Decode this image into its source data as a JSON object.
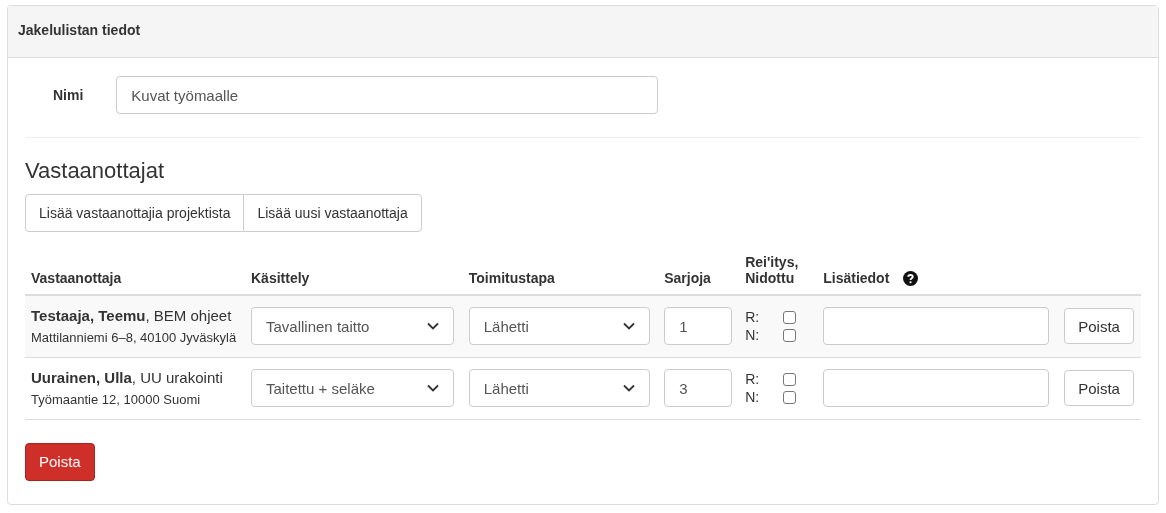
{
  "panel": {
    "title": "Jakelulistan tiedot"
  },
  "name_field": {
    "label": "Nimi",
    "value": "Kuvat työmaalle"
  },
  "recipients": {
    "heading": "Vastaanottajat",
    "buttons": [
      "Lisää vastaanottajia projektista",
      "Lisää uusi vastaanottaja"
    ],
    "columns": [
      "Vastaanottaja",
      "Käsittely",
      "Toimitustapa",
      "Sarjoja",
      "Rei'itys, Nidottu",
      "Lisätiedot"
    ],
    "rows": [
      {
        "name": "Testaaja, Teemu",
        "org": ", BEM ohjeet",
        "address": "Mattilanniemi 6–8, 40100 Jyväskylä",
        "handling": "Tavallinen taitto",
        "delivery": "Lähetti",
        "sets": "1",
        "r_label": "R:",
        "punched": false,
        "n_label": "N:",
        "bound": false,
        "delete": "Poista"
      },
      {
        "name": "Uurainen, Ulla",
        "org": ", UU urakointi",
        "address": "Työmaantie 12, 10000 Suomi",
        "handling": "Taitettu + seläke",
        "delivery": "Lähetti",
        "sets": "3",
        "r_label": "R:",
        "punched": false,
        "n_label": "N:",
        "bound": false,
        "delete": "Poista"
      }
    ]
  },
  "delete_button": "Poista"
}
